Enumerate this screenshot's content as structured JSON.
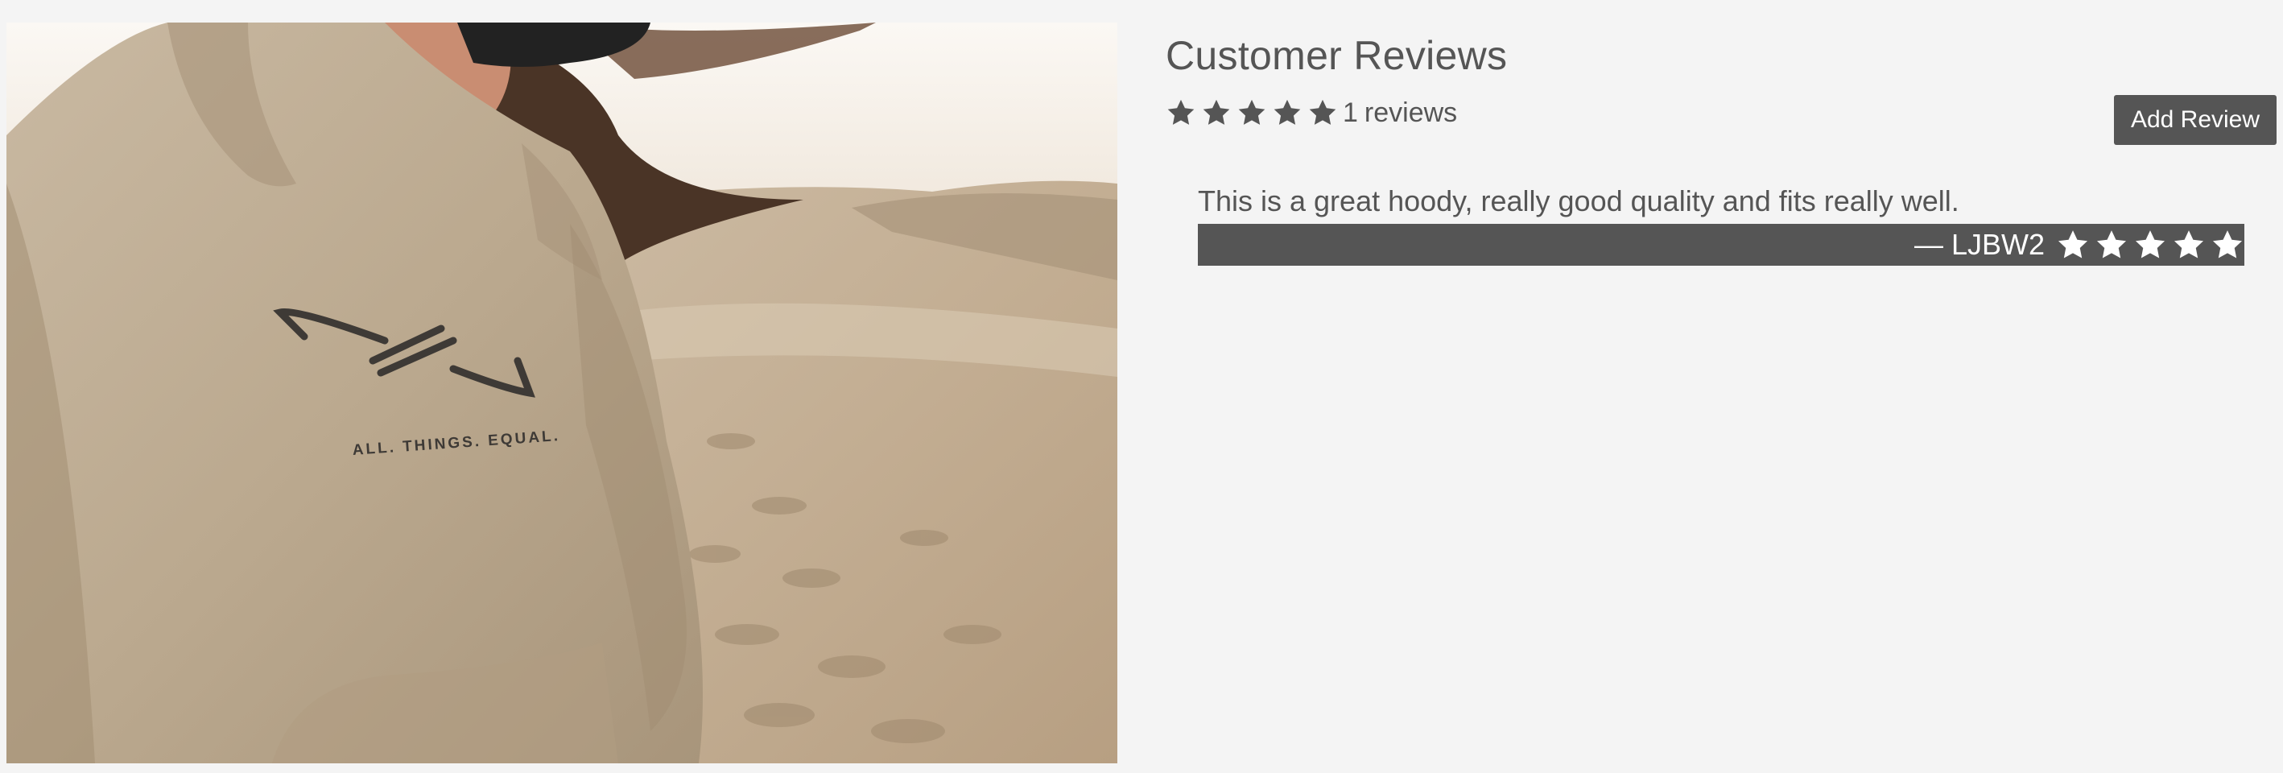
{
  "photo": {
    "alt": "Person in a beige hoodie standing on sand dunes",
    "hoodie_print": "ALL. THINGS. EQUAL."
  },
  "reviews": {
    "title": "Customer Reviews",
    "average_rating": 5,
    "max_rating": 5,
    "count": "1",
    "count_label": "reviews",
    "star_icon": "star-icon",
    "add_button_label": "Add Review",
    "items": [
      {
        "text": "This is a great hoody, really good quality and fits really well.",
        "author": "— LJBW2",
        "rating": 5
      }
    ]
  },
  "colors": {
    "background": "#f4f4f4",
    "text": "#555555",
    "accent_dark": "#555555",
    "on_dark": "#ffffff"
  }
}
